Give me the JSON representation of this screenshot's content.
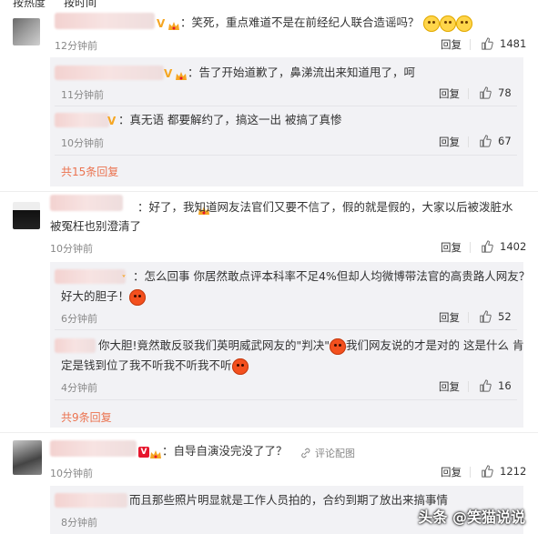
{
  "sort": {
    "hot": "按热度",
    "time": "按时间"
  },
  "actions": {
    "reply": "回复"
  },
  "comments": [
    {
      "text": "：笑死，重点难道不是在前经纪人联合造谣吗？",
      "time": "12分钟前",
      "likes": "1481",
      "replies": [
        {
          "text": "：告了开始道歉了，鼻涕流出来知道甩了，呵",
          "time": "11分钟前",
          "likes": "78"
        },
        {
          "text": "：真无语 都要解约了，搞这一出 被搞了真惨",
          "time": "10分钟前",
          "likes": "67"
        }
      ],
      "more": "共15条回复"
    },
    {
      "text": "：好了，我知道网友法官们又要不信了，假的就是假的，大家以后被泼脏水被冤枉也别澄清了",
      "time": "10分钟前",
      "likes": "1402",
      "replies": [
        {
          "text": "：怎么回事 你居然敢点评本科率不足4%但却人均微博带法官的高贵路人网友？",
          "text2": "好大的胆子！",
          "time": "6分钟前",
          "likes": "52"
        },
        {
          "text": "你大胆!竟然敢反驳我们英明威武网友的\"判决\"",
          "text_b": "我们网友说的才是对的 这是什么 肯",
          "text2": "定是钱到位了我不听我不听我不听",
          "time": "4分钟前",
          "likes": "16"
        }
      ],
      "more": "共9条回复"
    },
    {
      "text": "：自导自演没完没了了？",
      "comment_label": "评论配图",
      "time": "10分钟前",
      "likes": "1212",
      "replies": [
        {
          "text": "而且那些照片明显就是工作人员拍的，合约到期了放出来搞事情",
          "time": "8分钟前"
        }
      ]
    }
  ],
  "watermark": "头条 @笑猫说说",
  "colors": {
    "accent": "#eb7350",
    "subbg": "#f2f2f5",
    "vip_gold": "#f5a623"
  }
}
